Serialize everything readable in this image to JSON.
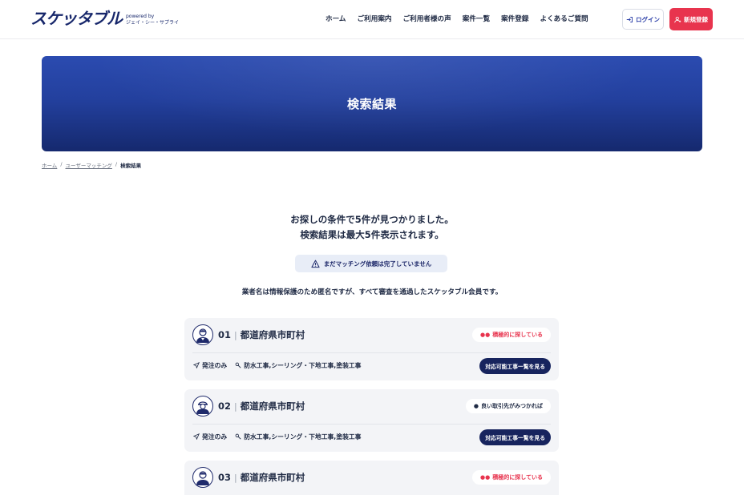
{
  "header": {
    "logo_text": "スケッタブル",
    "powered_by": "powered by",
    "company": "ジェイ・シー・サプライ",
    "nav": [
      "ホーム",
      "ご利用案内",
      "ご利用者様の声",
      "案件一覧",
      "案件登録",
      "よくあるご質問"
    ],
    "login_label": "ログイン",
    "register_label": "新規登録"
  },
  "hero": {
    "title": "検索結果"
  },
  "breadcrumb": {
    "home": "ホーム",
    "sep": "/",
    "parent": "ユーザーマッチング",
    "current": "検索結果"
  },
  "result": {
    "line1": "お探しの条件で5件が見つかりました。",
    "line2": "検索結果は最大5件表示されます。",
    "notice": "まだマッチング依頼は完了していません",
    "anon_note": "業者名は情報保護のため匿名ですが、すべて審査を通過したスケッタブル会員です。"
  },
  "cards": [
    {
      "num": "01",
      "sep": "|",
      "location": "都道府県市町村",
      "status": "積極的に探している",
      "status_type": "hot",
      "order_type": "発注のみ",
      "works": "防水工事,シーリング・下地工事,塗装工事",
      "button": "対応可能工事一覧を見る"
    },
    {
      "num": "02",
      "sep": "|",
      "location": "都道府県市町村",
      "status": "良い取引先がみつかれば",
      "status_type": "good",
      "order_type": "発注のみ",
      "works": "防水工事,シーリング・下地工事,塗装工事",
      "button": "対応可能工事一覧を見る"
    },
    {
      "num": "03",
      "sep": "|",
      "location": "都道府県市町村",
      "status": "積極的に探している",
      "status_type": "hot",
      "order_type": "",
      "works": "",
      "button": ""
    }
  ],
  "colors": {
    "brand_navy": "#17276b",
    "accent_red": "#e8344e",
    "hero_blue": "#23409e"
  }
}
